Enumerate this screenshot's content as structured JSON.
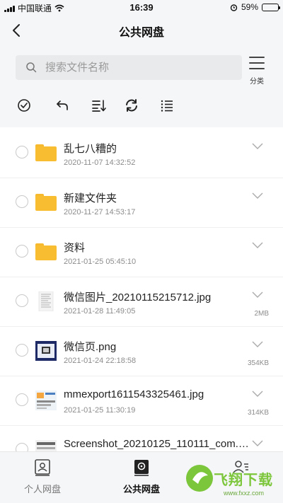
{
  "status_bar": {
    "carrier": "中国联通",
    "time": "16:39",
    "battery": "59%",
    "battery_level": 0.59
  },
  "nav": {
    "title": "公共网盘",
    "back_icon": "chevron-left-icon"
  },
  "search": {
    "placeholder": "搜索文件名称",
    "category_label": "分类"
  },
  "toolbar": {
    "icons": [
      "check-circle-icon",
      "undo-icon",
      "sort-icon",
      "refresh-icon",
      "list-icon"
    ]
  },
  "files": [
    {
      "name": "乱七八糟的",
      "date": "2020-11-07 14:32:52",
      "size": "",
      "type": "folder"
    },
    {
      "name": "新建文件夹",
      "date": "2020-11-27 14:53:17",
      "size": "",
      "type": "folder"
    },
    {
      "name": "资料",
      "date": "2021-01-25 05:45:10",
      "size": "",
      "type": "folder"
    },
    {
      "name": "微信图片_20210115215712.jpg",
      "date": "2021-01-28 11:49:05",
      "size": "2MB",
      "type": "image"
    },
    {
      "name": "微信页.png",
      "date": "2021-01-24 22:18:58",
      "size": "354KB",
      "type": "image"
    },
    {
      "name": "mmexport1611543325461.jpg",
      "date": "2021-01-25 11:30:19",
      "size": "314KB",
      "type": "image"
    },
    {
      "name": "Screenshot_20210125_110111_com.te...",
      "date": "",
      "size": "",
      "type": "image"
    }
  ],
  "tabbar": {
    "tabs": [
      {
        "label": "个人网盘",
        "active": false
      },
      {
        "label": "公共网盘",
        "active": true
      },
      {
        "label": "",
        "active": false
      }
    ]
  },
  "watermark": {
    "text": "飞翔下载",
    "url": "www.fxxz.com"
  },
  "colors": {
    "folder": "#f8bd31",
    "background": "#f5f6f8",
    "watermark": "#7cc63b"
  }
}
